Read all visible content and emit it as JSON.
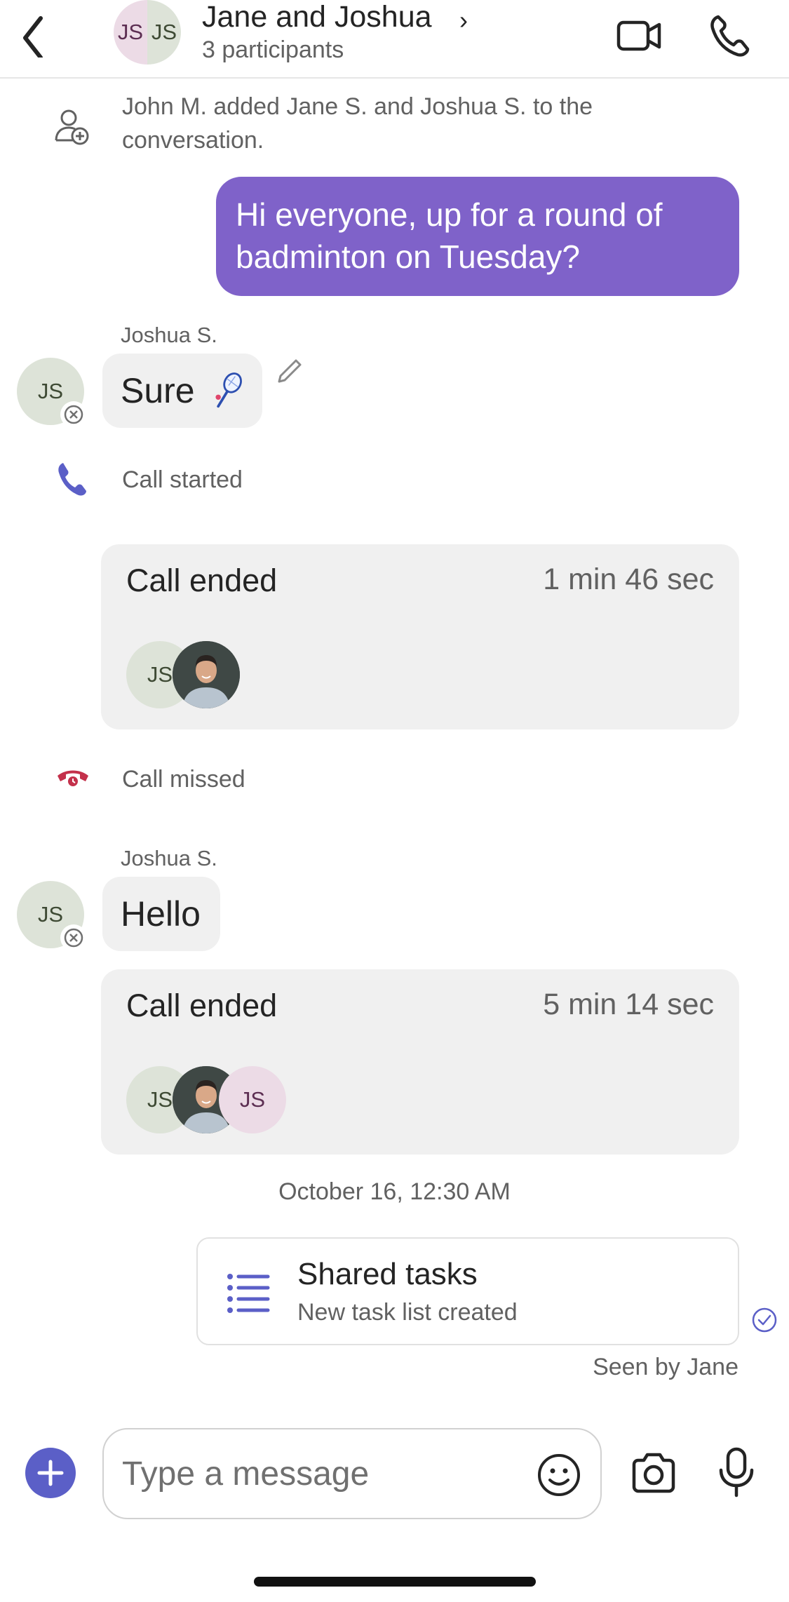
{
  "header": {
    "title": "Jane and Joshua",
    "chevron": "›",
    "subtitle": "3 participants",
    "avatar_left_initials": "JS",
    "avatar_right_initials": "JS",
    "icons": [
      "back-arrow-icon",
      "video-camera-icon",
      "phone-icon"
    ]
  },
  "messages": {
    "system_added": "John M. added Jane S. and Joshua S. to the conversation.",
    "me_message": "Hi everyone, up for a round of badminton on Tuesday?",
    "joshua_sender_1": "Joshua S.",
    "joshua_initials": "JS",
    "joshua_msg_1": "Sure",
    "call_started": "Call started",
    "call_1": {
      "title": "Call ended",
      "duration": "1 min 46 sec",
      "p1_initials": "JS"
    },
    "call_missed": "Call missed",
    "joshua_sender_2": "Joshua S.",
    "joshua_msg_2": "Hello",
    "call_2": {
      "title": "Call ended",
      "duration": "5 min 14 sec",
      "p1_initials": "JS",
      "p3_initials": "JS"
    },
    "timestamp": "October 16, 12:30 AM",
    "tasks": {
      "title": "Shared tasks",
      "subtitle": "New task list created"
    },
    "seen": "Seen by Jane"
  },
  "composer": {
    "placeholder": "Type a message",
    "icons": [
      "plus-icon",
      "emoji-icon",
      "camera-icon",
      "microphone-icon"
    ]
  },
  "colors": {
    "accent": "#5b5fc7",
    "my_bubble": "#7f62c9",
    "missed_call": "#c4314b"
  }
}
